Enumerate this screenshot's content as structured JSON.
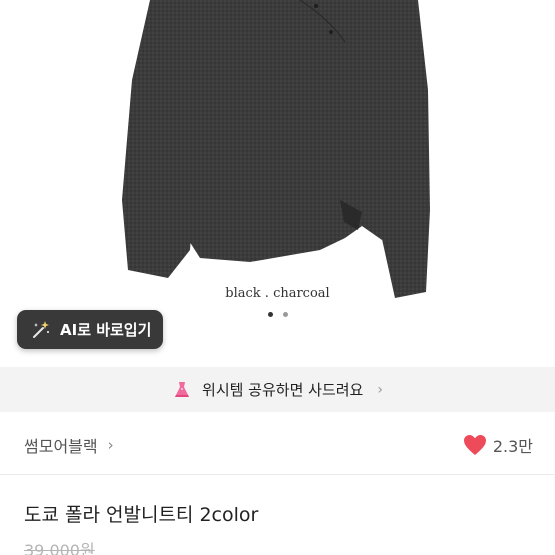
{
  "product_image": {
    "caption": "black . charcoal",
    "slide_count": 2,
    "active_slide": 1
  },
  "ai_button": {
    "label": "AI로 바로입기",
    "icon": "magic-wand-icon"
  },
  "wishlist_banner": {
    "text": "위시템 공유하면 사드려요",
    "icon": "dress-icon",
    "chevron": "›"
  },
  "store": {
    "name": "썸모어블랙",
    "chevron": "›"
  },
  "likes": {
    "count": "2.3만",
    "icon": "heart-icon",
    "color": "#ee4b5a"
  },
  "product": {
    "title": "도쿄 폴라 언발니트티 2color",
    "original_price": "39,000원"
  }
}
